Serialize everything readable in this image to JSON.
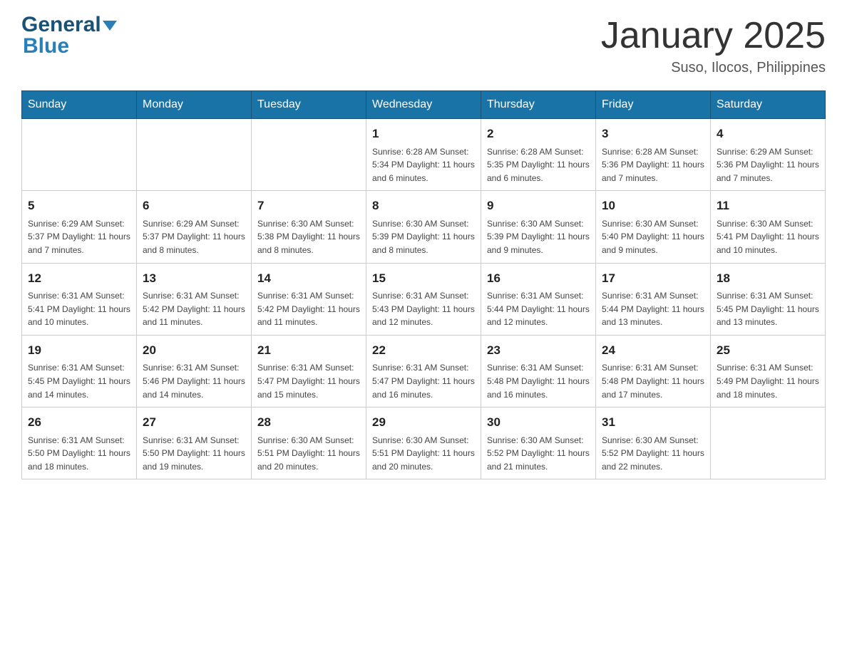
{
  "header": {
    "logo_line1": "General",
    "logo_line2": "Blue",
    "month_title": "January 2025",
    "location": "Suso, Ilocos, Philippines"
  },
  "days_of_week": [
    "Sunday",
    "Monday",
    "Tuesday",
    "Wednesday",
    "Thursday",
    "Friday",
    "Saturday"
  ],
  "weeks": [
    [
      {
        "day": "",
        "info": ""
      },
      {
        "day": "",
        "info": ""
      },
      {
        "day": "",
        "info": ""
      },
      {
        "day": "1",
        "info": "Sunrise: 6:28 AM\nSunset: 5:34 PM\nDaylight: 11 hours and 6 minutes."
      },
      {
        "day": "2",
        "info": "Sunrise: 6:28 AM\nSunset: 5:35 PM\nDaylight: 11 hours and 6 minutes."
      },
      {
        "day": "3",
        "info": "Sunrise: 6:28 AM\nSunset: 5:36 PM\nDaylight: 11 hours and 7 minutes."
      },
      {
        "day": "4",
        "info": "Sunrise: 6:29 AM\nSunset: 5:36 PM\nDaylight: 11 hours and 7 minutes."
      }
    ],
    [
      {
        "day": "5",
        "info": "Sunrise: 6:29 AM\nSunset: 5:37 PM\nDaylight: 11 hours and 7 minutes."
      },
      {
        "day": "6",
        "info": "Sunrise: 6:29 AM\nSunset: 5:37 PM\nDaylight: 11 hours and 8 minutes."
      },
      {
        "day": "7",
        "info": "Sunrise: 6:30 AM\nSunset: 5:38 PM\nDaylight: 11 hours and 8 minutes."
      },
      {
        "day": "8",
        "info": "Sunrise: 6:30 AM\nSunset: 5:39 PM\nDaylight: 11 hours and 8 minutes."
      },
      {
        "day": "9",
        "info": "Sunrise: 6:30 AM\nSunset: 5:39 PM\nDaylight: 11 hours and 9 minutes."
      },
      {
        "day": "10",
        "info": "Sunrise: 6:30 AM\nSunset: 5:40 PM\nDaylight: 11 hours and 9 minutes."
      },
      {
        "day": "11",
        "info": "Sunrise: 6:30 AM\nSunset: 5:41 PM\nDaylight: 11 hours and 10 minutes."
      }
    ],
    [
      {
        "day": "12",
        "info": "Sunrise: 6:31 AM\nSunset: 5:41 PM\nDaylight: 11 hours and 10 minutes."
      },
      {
        "day": "13",
        "info": "Sunrise: 6:31 AM\nSunset: 5:42 PM\nDaylight: 11 hours and 11 minutes."
      },
      {
        "day": "14",
        "info": "Sunrise: 6:31 AM\nSunset: 5:42 PM\nDaylight: 11 hours and 11 minutes."
      },
      {
        "day": "15",
        "info": "Sunrise: 6:31 AM\nSunset: 5:43 PM\nDaylight: 11 hours and 12 minutes."
      },
      {
        "day": "16",
        "info": "Sunrise: 6:31 AM\nSunset: 5:44 PM\nDaylight: 11 hours and 12 minutes."
      },
      {
        "day": "17",
        "info": "Sunrise: 6:31 AM\nSunset: 5:44 PM\nDaylight: 11 hours and 13 minutes."
      },
      {
        "day": "18",
        "info": "Sunrise: 6:31 AM\nSunset: 5:45 PM\nDaylight: 11 hours and 13 minutes."
      }
    ],
    [
      {
        "day": "19",
        "info": "Sunrise: 6:31 AM\nSunset: 5:45 PM\nDaylight: 11 hours and 14 minutes."
      },
      {
        "day": "20",
        "info": "Sunrise: 6:31 AM\nSunset: 5:46 PM\nDaylight: 11 hours and 14 minutes."
      },
      {
        "day": "21",
        "info": "Sunrise: 6:31 AM\nSunset: 5:47 PM\nDaylight: 11 hours and 15 minutes."
      },
      {
        "day": "22",
        "info": "Sunrise: 6:31 AM\nSunset: 5:47 PM\nDaylight: 11 hours and 16 minutes."
      },
      {
        "day": "23",
        "info": "Sunrise: 6:31 AM\nSunset: 5:48 PM\nDaylight: 11 hours and 16 minutes."
      },
      {
        "day": "24",
        "info": "Sunrise: 6:31 AM\nSunset: 5:48 PM\nDaylight: 11 hours and 17 minutes."
      },
      {
        "day": "25",
        "info": "Sunrise: 6:31 AM\nSunset: 5:49 PM\nDaylight: 11 hours and 18 minutes."
      }
    ],
    [
      {
        "day": "26",
        "info": "Sunrise: 6:31 AM\nSunset: 5:50 PM\nDaylight: 11 hours and 18 minutes."
      },
      {
        "day": "27",
        "info": "Sunrise: 6:31 AM\nSunset: 5:50 PM\nDaylight: 11 hours and 19 minutes."
      },
      {
        "day": "28",
        "info": "Sunrise: 6:30 AM\nSunset: 5:51 PM\nDaylight: 11 hours and 20 minutes."
      },
      {
        "day": "29",
        "info": "Sunrise: 6:30 AM\nSunset: 5:51 PM\nDaylight: 11 hours and 20 minutes."
      },
      {
        "day": "30",
        "info": "Sunrise: 6:30 AM\nSunset: 5:52 PM\nDaylight: 11 hours and 21 minutes."
      },
      {
        "day": "31",
        "info": "Sunrise: 6:30 AM\nSunset: 5:52 PM\nDaylight: 11 hours and 22 minutes."
      },
      {
        "day": "",
        "info": ""
      }
    ]
  ]
}
